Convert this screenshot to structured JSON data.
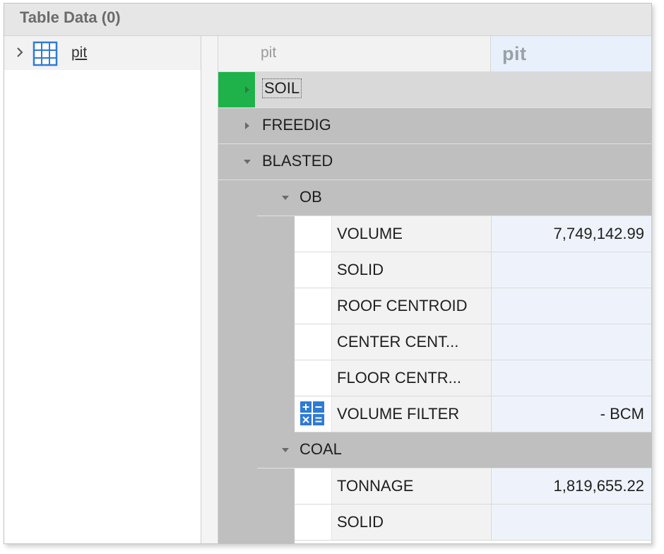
{
  "header": {
    "title": "Table Data (0)"
  },
  "tree": {
    "items": [
      {
        "label": "pit",
        "icon": "table-grid-icon"
      }
    ]
  },
  "columns": {
    "col1": "pit",
    "col2": "pit"
  },
  "groups": {
    "soil": "SOIL",
    "freedig": "FREEDIG",
    "blasted": "BLASTED",
    "ob": "OB",
    "coal": "COAL"
  },
  "ob_rows": [
    {
      "name": "VOLUME",
      "value": "7,749,142.99"
    },
    {
      "name": "SOLID",
      "value": ""
    },
    {
      "name": "ROOF CENTROID",
      "value": ""
    },
    {
      "name": "CENTER CENT...",
      "value": ""
    },
    {
      "name": "FLOOR CENTR...",
      "value": ""
    },
    {
      "name": "VOLUME FILTER",
      "value": "- BCM",
      "icon": "calculator-icon"
    }
  ],
  "coal_rows": [
    {
      "name": "TONNAGE",
      "value": "1,819,655.22"
    },
    {
      "name": "SOLID",
      "value": ""
    }
  ],
  "colors": {
    "accent_green": "#1fb24a",
    "icon_blue": "#2e7bd6"
  }
}
